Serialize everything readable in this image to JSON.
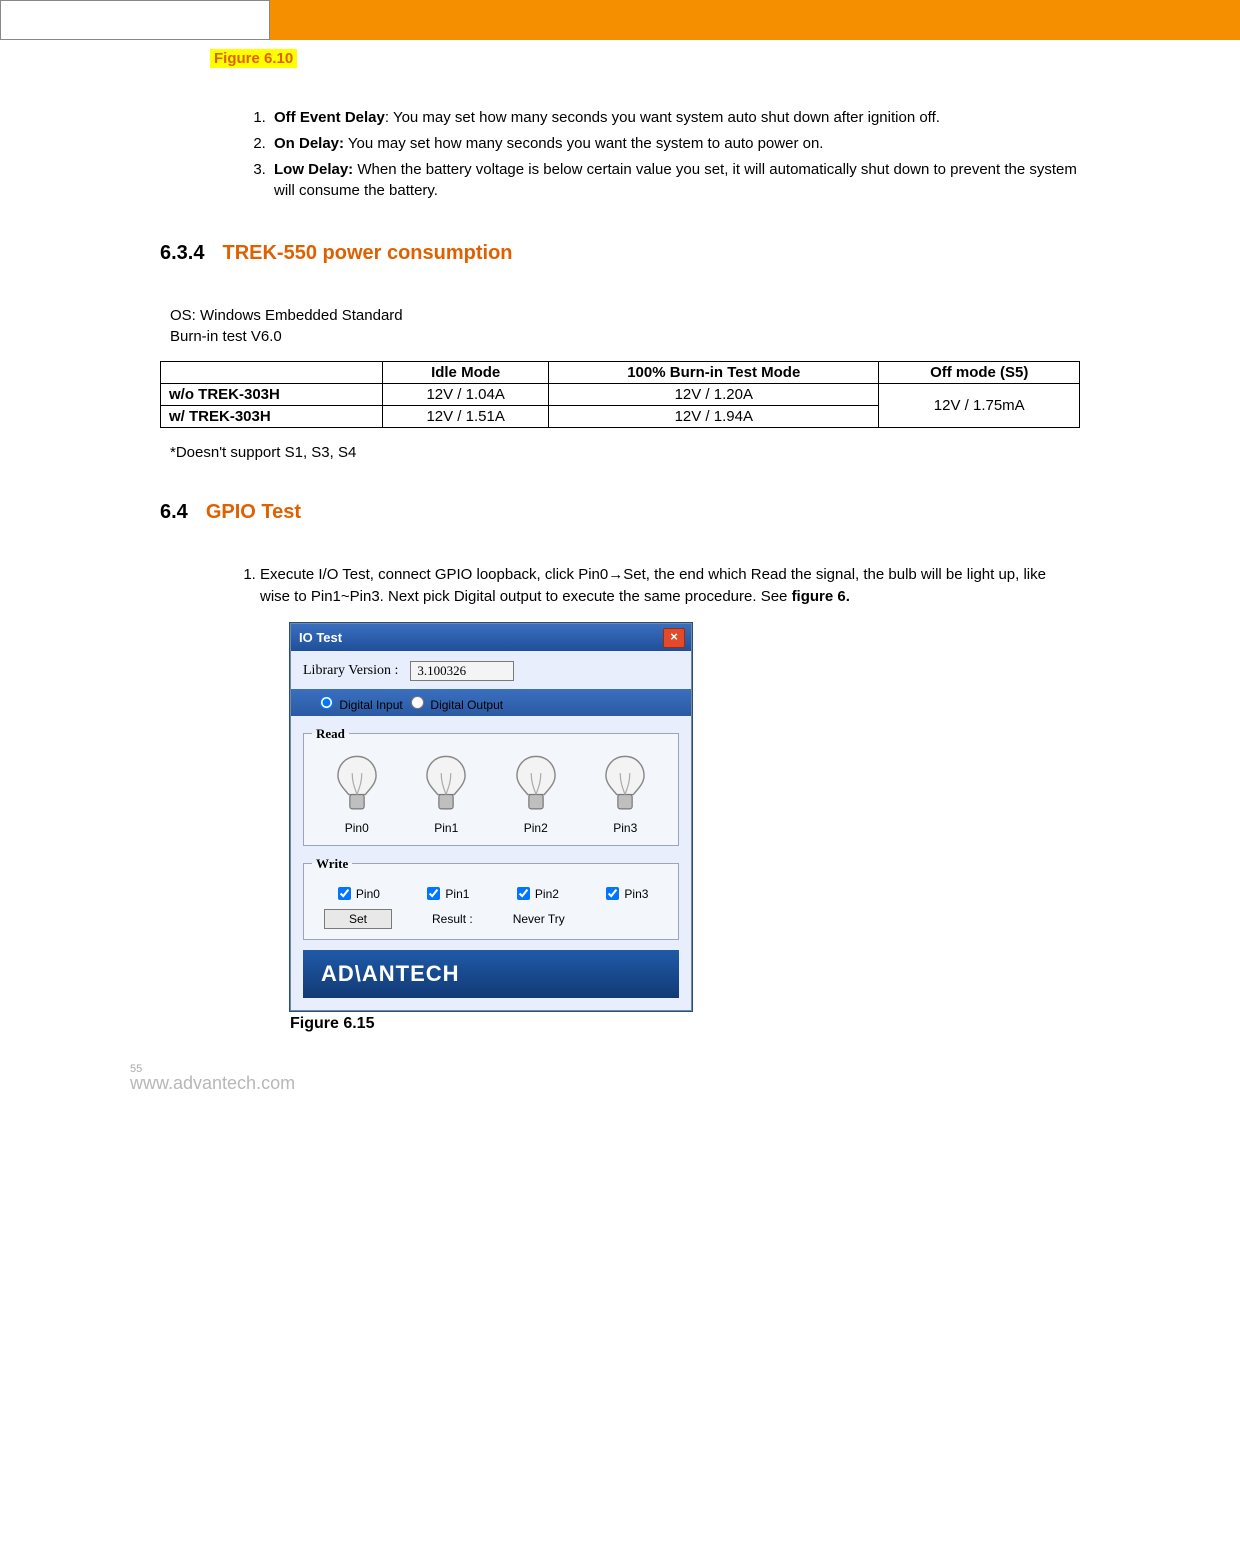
{
  "figure_top_label": "Figure 6.10",
  "defs": {
    "items": [
      {
        "term": "Off Event Delay",
        "rest": ": You may set how many seconds you want system auto shut down after ignition off."
      },
      {
        "term": "On Delay:",
        "rest": " You may set how many seconds you want the system to auto power on."
      },
      {
        "term": "Low Delay:",
        "rest": " When the battery voltage is below certain value you set, it will automatically shut down to prevent the system will consume the battery."
      }
    ]
  },
  "sec634": {
    "num": "6.3.4",
    "title": "TREK-550 power consumption"
  },
  "os_line1": "OS: Windows Embedded Standard",
  "os_line2": "Burn-in test V6.0",
  "table": {
    "headers": {
      "c0": "",
      "c1": "Idle Mode",
      "c2": "100% Burn-in Test Mode",
      "c3": "Off mode (S5)"
    },
    "rows": [
      {
        "label": "w/o TREK-303H",
        "idle": "12V / 1.04A",
        "burn": "12V / 1.20A"
      },
      {
        "label": "w/ TREK-303H",
        "idle": "12V / 1.51A",
        "burn": "12V / 1.94A"
      }
    ],
    "off_merged": "12V / 1.75mA"
  },
  "note": "*Doesn't support S1, S3, S4",
  "sec64": {
    "num": "6.4",
    "title": "GPIO Test"
  },
  "gpio_step": {
    "text_a": "Execute I/O Test, connect GPIO loopback, click Pin0→Set, the end which Read the signal, the bulb will be light up, like wise to Pin1~Pin3. Next pick Digital output to execute the same procedure. See ",
    "text_b": "figure 6."
  },
  "dialog": {
    "title": "IO Test",
    "close": "×",
    "lib_label": "Library Version :",
    "lib_value": "3.100326",
    "radio_di": "Digital Input",
    "radio_do": "Digital Output",
    "read_legend": "Read",
    "pins": [
      "Pin0",
      "Pin1",
      "Pin2",
      "Pin3"
    ],
    "write_legend": "Write",
    "write_pins": [
      "Pin0",
      "Pin1",
      "Pin2",
      "Pin3"
    ],
    "set_label": "Set",
    "result_label": "Result :",
    "result_value": "Never Try",
    "brand": "AD\\ANTECH"
  },
  "figure_caption": "Figure 6.15",
  "footer": {
    "page": "55",
    "url": "www.advantech.com"
  }
}
